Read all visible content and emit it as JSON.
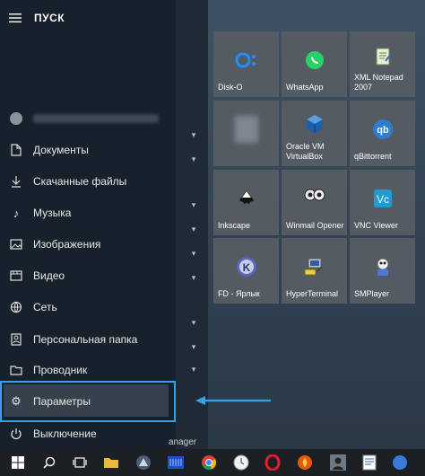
{
  "start_menu": {
    "header_label": "ПУСК",
    "items": [
      {
        "label": "Документы",
        "icon": "document-icon"
      },
      {
        "label": "Скачанные файлы",
        "icon": "download-icon"
      },
      {
        "label": "Музыка",
        "icon": "music-icon"
      },
      {
        "label": "Изображения",
        "icon": "image-icon"
      },
      {
        "label": "Видео",
        "icon": "video-icon"
      },
      {
        "label": "Сеть",
        "icon": "network-icon"
      },
      {
        "label": "Персональная папка",
        "icon": "folder-icon"
      },
      {
        "label": "Проводник",
        "icon": "explorer-icon"
      },
      {
        "label": "Параметры",
        "icon": "gear-icon"
      },
      {
        "label": "Выключение",
        "icon": "power-icon"
      }
    ]
  },
  "tiles": [
    {
      "label": "Disk-O"
    },
    {
      "label": "WhatsApp"
    },
    {
      "label": "XML Notepad 2007"
    },
    {
      "label": ""
    },
    {
      "label": "Oracle VM VirtualBox"
    },
    {
      "label": "qBittorrent"
    },
    {
      "label": "Inkscape"
    },
    {
      "label": "Winmail Opener"
    },
    {
      "label": "VNC Viewer"
    },
    {
      "label": "FD - Ярлык"
    },
    {
      "label": "HyperTerminal"
    },
    {
      "label": "SMPlayer"
    }
  ],
  "taskbar": {
    "partial_text": "anager"
  },
  "colors": {
    "highlight": "#3aa0e6",
    "tile": "#545b63"
  }
}
